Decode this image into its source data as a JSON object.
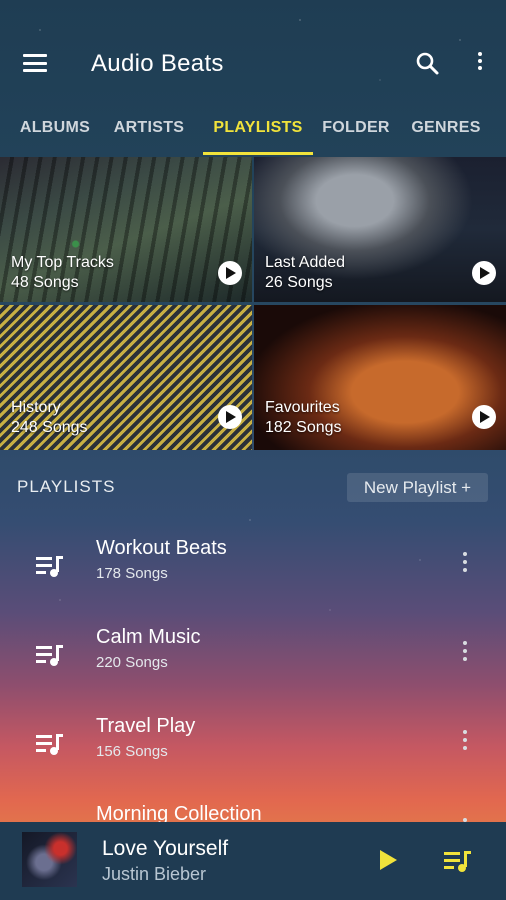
{
  "app": {
    "title": "Audio Beats"
  },
  "tabs": [
    {
      "label": "ALBUMS",
      "active": false
    },
    {
      "label": "ARTISTS",
      "active": false
    },
    {
      "label": "PLAYLISTS",
      "active": true
    },
    {
      "label": "FOLDER",
      "active": false
    },
    {
      "label": "GENRES",
      "active": false
    }
  ],
  "featured": [
    {
      "title": "My Top Tracks",
      "count": "48 Songs"
    },
    {
      "title": "Last Added",
      "count": "26 Songs"
    },
    {
      "title": "History",
      "count": "248 Songs"
    },
    {
      "title": "Favourites",
      "count": "182 Songs"
    }
  ],
  "playlists_section": {
    "title": "PLAYLISTS",
    "new_button": "New Playlist +"
  },
  "playlists": [
    {
      "name": "Workout Beats",
      "count": "178 Songs"
    },
    {
      "name": "Calm Music",
      "count": "220 Songs"
    },
    {
      "name": "Travel Play",
      "count": "156 Songs"
    },
    {
      "name": "Morning Collection",
      "count": ""
    }
  ],
  "now_playing": {
    "title": "Love Yourself",
    "artist": "Justin Bieber"
  },
  "colors": {
    "accent": "#f1e33b",
    "now_playing_bar": "#1f3b52"
  },
  "icons": [
    "menu-icon",
    "search-icon",
    "more-vertical-icon",
    "play-icon",
    "playlist-icon",
    "queue-icon"
  ]
}
